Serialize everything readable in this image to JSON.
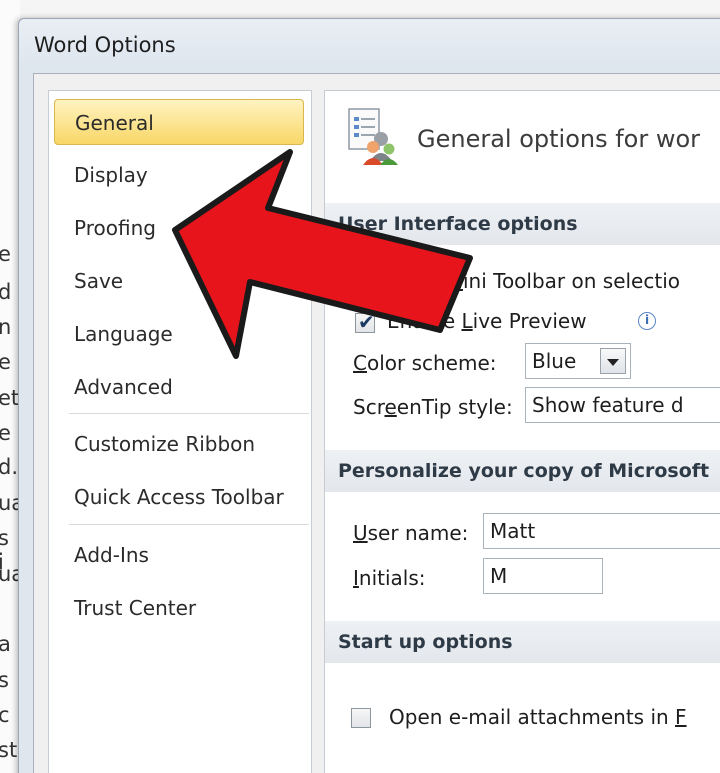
{
  "background_doc": {
    "fragments": [
      "e",
      "d",
      "n",
      "e",
      "et",
      "e",
      "d.",
      "ua",
      "s i",
      "ua",
      "a",
      "s",
      "c",
      "st"
    ]
  },
  "window": {
    "title": "Word Options"
  },
  "nav": {
    "items": [
      {
        "label": "General",
        "selected": true
      },
      {
        "label": "Display"
      },
      {
        "label": "Proofing"
      },
      {
        "label": "Save"
      },
      {
        "label": "Language"
      },
      {
        "label": "Advanced"
      },
      {
        "label": "Customize Ribbon"
      },
      {
        "label": "Quick Access Toolbar"
      },
      {
        "label": "Add-Ins"
      },
      {
        "label": "Trust Center"
      }
    ]
  },
  "content": {
    "header_title": "General options for wor",
    "sections": {
      "ui": {
        "title": "User Interface options",
        "mini_toolbar_label_pre": "w ",
        "mini_toolbar_label_key": "M",
        "mini_toolbar_label_post": "ini Toolbar on selectio",
        "live_preview_label_pre": "Enable ",
        "live_preview_label_key": "L",
        "live_preview_label_post": "ive Preview",
        "color_scheme_label_key": "C",
        "color_scheme_label_post": "olor scheme:",
        "color_scheme_value": "Blue",
        "screentip_label_pre": "Scr",
        "screentip_label_key": "e",
        "screentip_label_post": "enTip style:",
        "screentip_value": "Show feature d"
      },
      "personalize": {
        "title": "Personalize your copy of Microsoft",
        "username_label_key": "U",
        "username_label_post": "ser name:",
        "username_value": "Matt",
        "initials_label_key": "I",
        "initials_label_post": "nitials:",
        "initials_value": "M"
      },
      "startup": {
        "title": "Start up options",
        "email_label": "Open e-mail attachments in ",
        "email_label_key": "F"
      }
    }
  },
  "colors": {
    "selected_nav": "#f8d767",
    "arrow_red": "#e8141b",
    "arrow_outline": "#1a1a1a"
  }
}
